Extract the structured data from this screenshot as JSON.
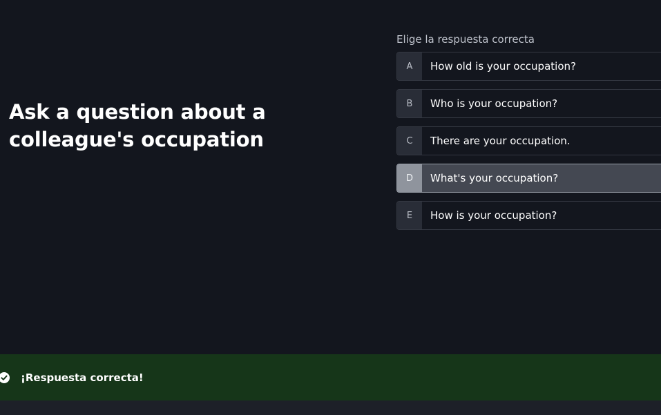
{
  "question": {
    "title": "Ask a question about a colleague's occupation"
  },
  "prompt": {
    "label": "Elige la respuesta correcta"
  },
  "options": [
    {
      "letter": "A",
      "text": "How old is your occupation?",
      "selected": false
    },
    {
      "letter": "B",
      "text": "Who is your occupation?",
      "selected": false
    },
    {
      "letter": "C",
      "text": "There are your occupation.",
      "selected": false
    },
    {
      "letter": "D",
      "text": "What's your occupation?",
      "selected": true
    },
    {
      "letter": "E",
      "text": "How is your occupation?",
      "selected": false
    }
  ],
  "feedback": {
    "message": "¡Respuesta correcta!",
    "icon": "check-circle-icon",
    "color": "#163619"
  },
  "colors": {
    "background": "#13161e",
    "selected_option": "#444852",
    "success": "#163619"
  }
}
